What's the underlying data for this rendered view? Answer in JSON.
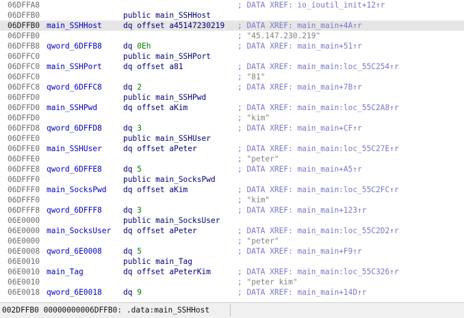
{
  "listing": {
    "rows": [
      {
        "addr": "06DFFA8",
        "label": "",
        "instr": "",
        "op": "",
        "comment": "; DATA XREF: io_ioutil_init+12↑r",
        "string": "",
        "highlight": false
      },
      {
        "addr": "06DFFB0",
        "label": "",
        "instr": "public main_SSHHost",
        "op": "",
        "comment": "",
        "string": "",
        "highlight": false
      },
      {
        "addr": "06DFFB0",
        "label": "main_SSHHost",
        "instr": "dq offset a45147230219",
        "op": "",
        "comment": "; DATA XREF: main_main+4A↑r",
        "string": "",
        "highlight": true
      },
      {
        "addr": "06DFFB0",
        "label": "",
        "instr": "",
        "op": "",
        "comment": "; ",
        "string": "\"45.147.230.219\"",
        "highlight": false
      },
      {
        "addr": "06DFFB8",
        "label": "qword_6DFFB8",
        "instr": "dq ",
        "op": "0Eh",
        "comment": "; DATA XREF: main_main+51↑r",
        "string": "",
        "highlight": false
      },
      {
        "addr": "06DFFC0",
        "label": "",
        "instr": "public main_SSHPort",
        "op": "",
        "comment": "",
        "string": "",
        "highlight": false
      },
      {
        "addr": "06DFFC0",
        "label": "main_SSHPort",
        "instr": "dq offset a81",
        "op": "",
        "comment": "; DATA XREF: main_main:loc_55C254↑r",
        "string": "",
        "highlight": false
      },
      {
        "addr": "06DFFC0",
        "label": "",
        "instr": "",
        "op": "",
        "comment": "; ",
        "string": "\"81\"",
        "highlight": false
      },
      {
        "addr": "06DFFC8",
        "label": "qword_6DFFC8",
        "instr": "dq ",
        "op": "2",
        "comment": "; DATA XREF: main_main+7B↑r",
        "string": "",
        "highlight": false
      },
      {
        "addr": "06DFFD0",
        "label": "",
        "instr": "public main_SSHPwd",
        "op": "",
        "comment": "",
        "string": "",
        "highlight": false
      },
      {
        "addr": "06DFFD0",
        "label": "main_SSHPwd",
        "instr": "dq offset aKim",
        "op": "",
        "comment": "; DATA XREF: main_main:loc_55C2A8↑r",
        "string": "",
        "highlight": false
      },
      {
        "addr": "06DFFD0",
        "label": "",
        "instr": "",
        "op": "",
        "comment": "; ",
        "string": "\"kim\"",
        "highlight": false
      },
      {
        "addr": "06DFFD8",
        "label": "qword_6DFFD8",
        "instr": "dq ",
        "op": "3",
        "comment": "; DATA XREF: main_main+CF↑r",
        "string": "",
        "highlight": false
      },
      {
        "addr": "06DFFE0",
        "label": "",
        "instr": "public main_SSHUser",
        "op": "",
        "comment": "",
        "string": "",
        "highlight": false
      },
      {
        "addr": "06DFFE0",
        "label": "main_SSHUser",
        "instr": "dq offset aPeter",
        "op": "",
        "comment": "; DATA XREF: main_main:loc_55C27E↑r",
        "string": "",
        "highlight": false
      },
      {
        "addr": "06DFFE0",
        "label": "",
        "instr": "",
        "op": "",
        "comment": "; ",
        "string": "\"peter\"",
        "highlight": false
      },
      {
        "addr": "06DFFE8",
        "label": "qword_6DFFE8",
        "instr": "dq ",
        "op": "5",
        "comment": "; DATA XREF: main_main+A5↑r",
        "string": "",
        "highlight": false
      },
      {
        "addr": "06DFFF0",
        "label": "",
        "instr": "public main_SocksPwd",
        "op": "",
        "comment": "",
        "string": "",
        "highlight": false
      },
      {
        "addr": "06DFFF0",
        "label": "main_SocksPwd",
        "instr": "dq offset aKim",
        "op": "",
        "comment": "; DATA XREF: main_main:loc_55C2FC↑r",
        "string": "",
        "highlight": false
      },
      {
        "addr": "06DFFF0",
        "label": "",
        "instr": "",
        "op": "",
        "comment": "; ",
        "string": "\"kim\"",
        "highlight": false
      },
      {
        "addr": "06DFFF8",
        "label": "qword_6DFFF8",
        "instr": "dq ",
        "op": "3",
        "comment": "; DATA XREF: main_main+123↑r",
        "string": "",
        "highlight": false
      },
      {
        "addr": "06E0000",
        "label": "",
        "instr": "public main_SocksUser",
        "op": "",
        "comment": "",
        "string": "",
        "highlight": false
      },
      {
        "addr": "06E0000",
        "label": "main_SocksUser",
        "instr": "dq offset aPeter",
        "op": "",
        "comment": "; DATA XREF: main_main:loc_55C2D2↑r",
        "string": "",
        "highlight": false
      },
      {
        "addr": "06E0000",
        "label": "",
        "instr": "",
        "op": "",
        "comment": "; ",
        "string": "\"peter\"",
        "highlight": false
      },
      {
        "addr": "06E0008",
        "label": "qword_6E0008",
        "instr": "dq ",
        "op": "5",
        "comment": "; DATA XREF: main_main+F9↑r",
        "string": "",
        "highlight": false
      },
      {
        "addr": "06E0010",
        "label": "",
        "instr": "public main_Tag",
        "op": "",
        "comment": "",
        "string": "",
        "highlight": false
      },
      {
        "addr": "06E0010",
        "label": "main_Tag",
        "instr": "dq offset aPeterKim",
        "op": "",
        "comment": "; DATA XREF: main_main:loc_55C326↑r",
        "string": "",
        "highlight": false
      },
      {
        "addr": "06E0010",
        "label": "",
        "instr": "",
        "op": "",
        "comment": "; ",
        "string": "\"peter kim\"",
        "highlight": false
      },
      {
        "addr": "06E0018",
        "label": "qword_6E0018",
        "instr": "dq ",
        "op": "9",
        "comment": "; DATA XREF: main_main+14D↑r",
        "string": "",
        "highlight": false
      }
    ]
  },
  "statusbar": {
    "text": "002DFFB0 00000000006DFFB0: .data:main_SSHHost"
  }
}
